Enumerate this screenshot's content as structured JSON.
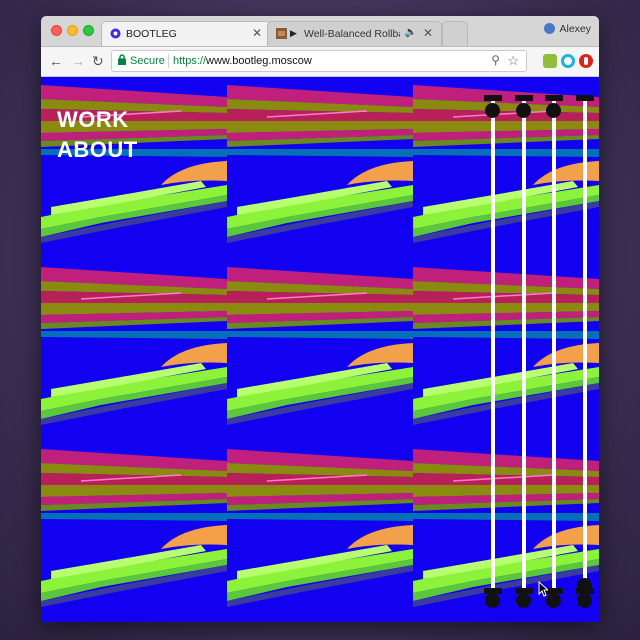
{
  "browser": {
    "tabs": [
      {
        "title": "BOOTLEG",
        "active": true
      },
      {
        "title": "Well-Balanced Rollback",
        "active": false,
        "playing": true
      }
    ],
    "user_name": "Alexey",
    "omnibox": {
      "secure_label": "Secure",
      "url_scheme": "https://",
      "url_host": "www.bootleg.moscow"
    },
    "icons": {
      "back": "back-arrow-icon",
      "forward": "forward-arrow-icon",
      "reload": "reload-icon",
      "zoom": "zoom-icon",
      "bookmark": "star-icon"
    }
  },
  "site": {
    "nav": [
      {
        "label": "WORK"
      },
      {
        "label": "ABOUT"
      }
    ],
    "colors": {
      "background": "#1200f0",
      "stripe_magenta": "#c0207c",
      "stripe_olive": "#8a8a10",
      "lime": "#8cf23a",
      "peach": "#f2a04a"
    },
    "tile_grid": {
      "columns": 3,
      "rows": 3
    },
    "sliders": [
      {
        "name": "slider-1",
        "position": 0.02
      },
      {
        "name": "slider-2",
        "position": 0.02
      },
      {
        "name": "slider-3",
        "position": 0.02
      },
      {
        "name": "slider-4",
        "position": 0.97
      }
    ]
  }
}
